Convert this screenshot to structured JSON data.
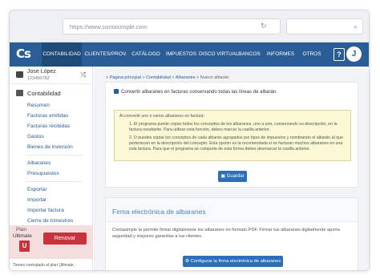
{
  "browser": {
    "url": "https://www.contasimple.com",
    "reload_icon": "reload-icon",
    "search_icon": "search-icon"
  },
  "nav": {
    "logo": "Cs",
    "items": [
      "CONTABILIDAD",
      "CLIENTES/PROV.",
      "CATÁLOGO",
      "IMPUESTOS",
      "DISCO VIRTUAL",
      "BANCOS",
      "INFORMES",
      "OTROS"
    ],
    "help": "?",
    "avatar": "J",
    "accent": "#2a5d96"
  },
  "sidebar": {
    "user_name": "Jose López",
    "user_id": "12345678Z",
    "section": "Contabilidad",
    "group1": [
      "Resumen",
      "Facturas emitidas",
      "Facturas recibidas",
      "Gastos",
      "Bienes de inversión"
    ],
    "group2": [
      "Albaranes",
      "Presupuestos"
    ],
    "group3": [
      "Exportar",
      "Importar",
      "Importar factura",
      "Cierre de trimestres"
    ],
    "plan": {
      "label": "Plan",
      "name": "Ultimate",
      "badge": "U",
      "renew": "Renovar",
      "note": "Tienes contratado el plan Ultimate,"
    }
  },
  "main": {
    "breadcrumb": {
      "items": [
        "Página principal",
        "Contabilidad",
        "Albaranes",
        "Nuevo albarán"
      ],
      "sep": " > "
    },
    "checkbox_label": "Convertir albaranes en facturas conservando todas las líneas de albarán.",
    "notice": {
      "intro": "Al convertir uno o varios albaranes en factura:",
      "point1": "1. El programa puede copiar todos los conceptos de los albaranes, uno a uno, conservando su descripción, en la factura resultante. Para utilizar esta función, debes marcar la casilla anterior.",
      "point2": "2. O puedes copiar los conceptos de cada albarán agrupados por tipos de impuestos y nombrando el albarán al que pertenecen en la descripción del concepto. Esta opción es la recomendada si se facturan muchos albaranes en una sola factura. Para que el programa se comporte de esta forma debes desmarcar la casilla anterior."
    },
    "save_button": "Guardar",
    "signature": {
      "title": "Firma electrónica de albaranes",
      "text": "Contasimple te permite firmar digitalmente los albaranes en formato PDF. Firmar tus albaranes digitalmente aporta seguridad y mayores garantías a tus clientes.",
      "button": "Configurar la firma electrónica de albaranes"
    }
  }
}
